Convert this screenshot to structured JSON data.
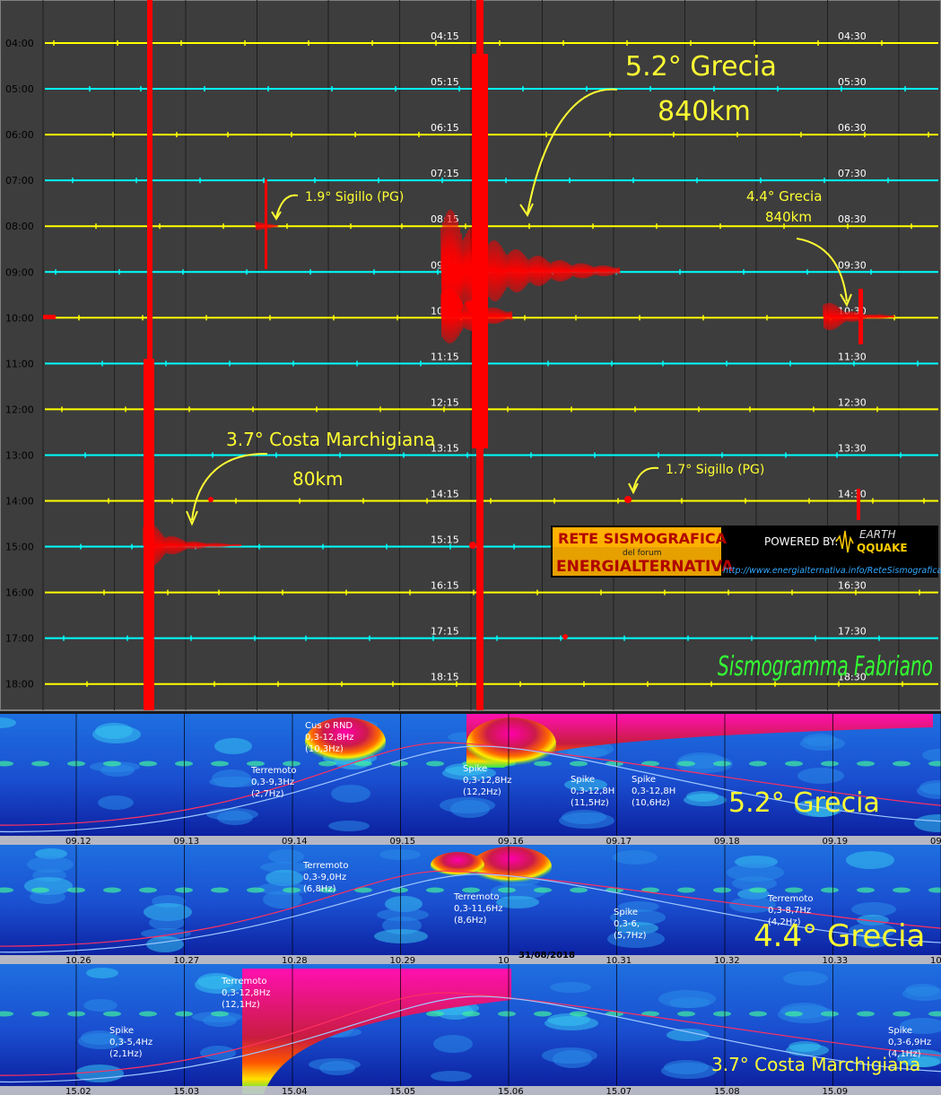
{
  "seismogram": {
    "left_times": [
      "04:00",
      "05:00",
      "06:00",
      "07:00",
      "08:00",
      "09:00",
      "10:00",
      "11:00",
      "12:00",
      "13:00",
      "14:00",
      "15:00",
      "16:00",
      "17:00",
      "18:00"
    ],
    "mid_times": [
      "04:15",
      "05:15",
      "06:15",
      "07:15",
      "08:15",
      "09:15",
      "10:15",
      "11:15",
      "12:15",
      "13:15",
      "14:15",
      "15:15",
      "16:15",
      "17:15",
      "18:15"
    ],
    "right_times": [
      "04:30",
      "05:30",
      "06:30",
      "07:30",
      "08:30",
      "09:30",
      "10:30",
      "11:30",
      "12:30",
      "13:30",
      "14:30",
      "15:30",
      "16:30",
      "17:30",
      "18:30"
    ],
    "colors": {
      "yellow_line": "#ffff00",
      "cyan_line": "#00ffff",
      "trace": "#ff0000",
      "annotation": "#ffff33",
      "title": "#33ff33",
      "background": "#3d3d3d"
    },
    "annotations": {
      "greece52_line1": "5.2° Grecia",
      "greece52_line2": "840km",
      "sigillo19": "1.9° Sigillo (PG)",
      "greece44_line1": "4.4° Grecia",
      "greece44_line2": "840km",
      "marche_line1": "3.7° Costa Marchigiana",
      "marche_line2": "80km",
      "sigillo17": "1.7° Sigillo (PG)"
    },
    "title": "Sismogramma Fabriano",
    "logo": {
      "line1": "RETE SISMOGRAFICA",
      "line2": "del forum",
      "line3": "ENERGIALTERNATIVA",
      "powered": "POWERED BY:",
      "earth": "EARTH",
      "qquake": "QQUAKE",
      "url": "http://www.energialternativa.info/ReteSismografica"
    }
  },
  "spectrograms": [
    {
      "ticks": [
        "09.12",
        "09.13",
        "09.14",
        "09.15",
        "09.16",
        "09.17",
        "09.18",
        "09.19",
        "09."
      ],
      "label": "5.2° Grecia",
      "notes": [
        {
          "l1": "Cus o RND",
          "l2": "0,3-12,8Hz",
          "l3": "(10,3Hz)"
        },
        {
          "l1": "Terremoto",
          "l2": "0,3-9,3Hz",
          "l3": "(2,7Hz)"
        },
        {
          "l1": "Spike",
          "l2": "0,3-12,8Hz",
          "l3": "(12,2Hz)"
        },
        {
          "l1": "Spike",
          "l2": "0,3-12,8H",
          "l3": "(11,5Hz)"
        },
        {
          "l1": "Spike",
          "l2": "0,3-12,8H",
          "l3": "(10,6Hz)"
        }
      ]
    },
    {
      "ticks": [
        "10.26",
        "10.27",
        "10.28",
        "10.29",
        "10",
        "10.31",
        "10.32",
        "10.33",
        "10.3"
      ],
      "label": "4.4° Grecia",
      "date": "31/08/2018",
      "notes": [
        {
          "l1": "Terremoto",
          "l2": "0,3-9,0Hz",
          "l3": "(6,8Hz)"
        },
        {
          "l1": "Terremoto",
          "l2": "0,3-11,6Hz",
          "l3": "(8,6Hz)"
        },
        {
          "l1": "Spike",
          "l2": "0,3-6,",
          "l3": "(5,7Hz)"
        },
        {
          "l1": "Terremoto",
          "l2": "0,3-8,7Hz",
          "l3": "(4,2Hz)"
        }
      ]
    },
    {
      "ticks": [
        "15.02",
        "15.03",
        "15.04",
        "15.05",
        "15.06",
        "15.07",
        "15.08",
        "15.09"
      ],
      "label": "3.7° Costa Marchigiana",
      "notes": [
        {
          "l1": "Terremoto",
          "l2": "0,3-12,8Hz",
          "l3": "(12,1Hz)"
        },
        {
          "l1": "Spike",
          "l2": "0,3-5,4Hz",
          "l3": "(2,1Hz)"
        },
        {
          "l1": "Spike",
          "l2": "0,3-6,9Hz",
          "l3": "(4,1Hz)"
        }
      ]
    }
  ]
}
